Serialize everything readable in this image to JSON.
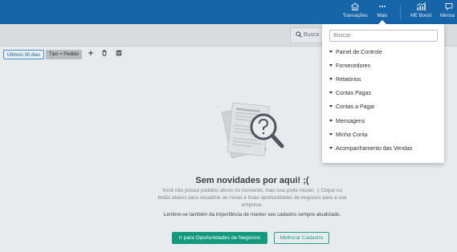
{
  "nav": {
    "items": [
      {
        "label": "Transações",
        "icon": "home-icon"
      },
      {
        "label": "Mais",
        "icon": "more-dots-icon"
      },
      {
        "label": "ME Boost",
        "icon": "chart-bars-icon"
      },
      {
        "label": "Mensa",
        "icon": "message-icon"
      }
    ]
  },
  "search": {
    "placeholder": "Busca"
  },
  "filters": {
    "chips": [
      "Últimos 30 dias",
      "Tipo = Pedido"
    ]
  },
  "dropdown": {
    "search_placeholder": "Buscar",
    "items": [
      "Painel de Controle",
      "Fornecedores",
      "Relatórios",
      "Contas Pagas",
      "Contas a Pagar",
      "Mensagens",
      "Minha Conta",
      "Acompanhamento das Vendas"
    ]
  },
  "empty_state": {
    "title": "Sem novidades por aqui! ;(",
    "body": "Você não possui pedidos ativos no momento, mas isso pode mudar. :) Clique no botão abaixo para visualizar as novas e boas oportunidades de negócios para a sua empresa.",
    "body2": "Lembre-se também da importância de manter seu cadastro sempre atualizado.",
    "primary_button": "Ir para Oportunidades de Negócios",
    "secondary_button": "Melhorar Cadastro"
  },
  "colors": {
    "topbar": "#1565a8",
    "primary_button": "#139a7c",
    "outline_button": "#22a387"
  }
}
